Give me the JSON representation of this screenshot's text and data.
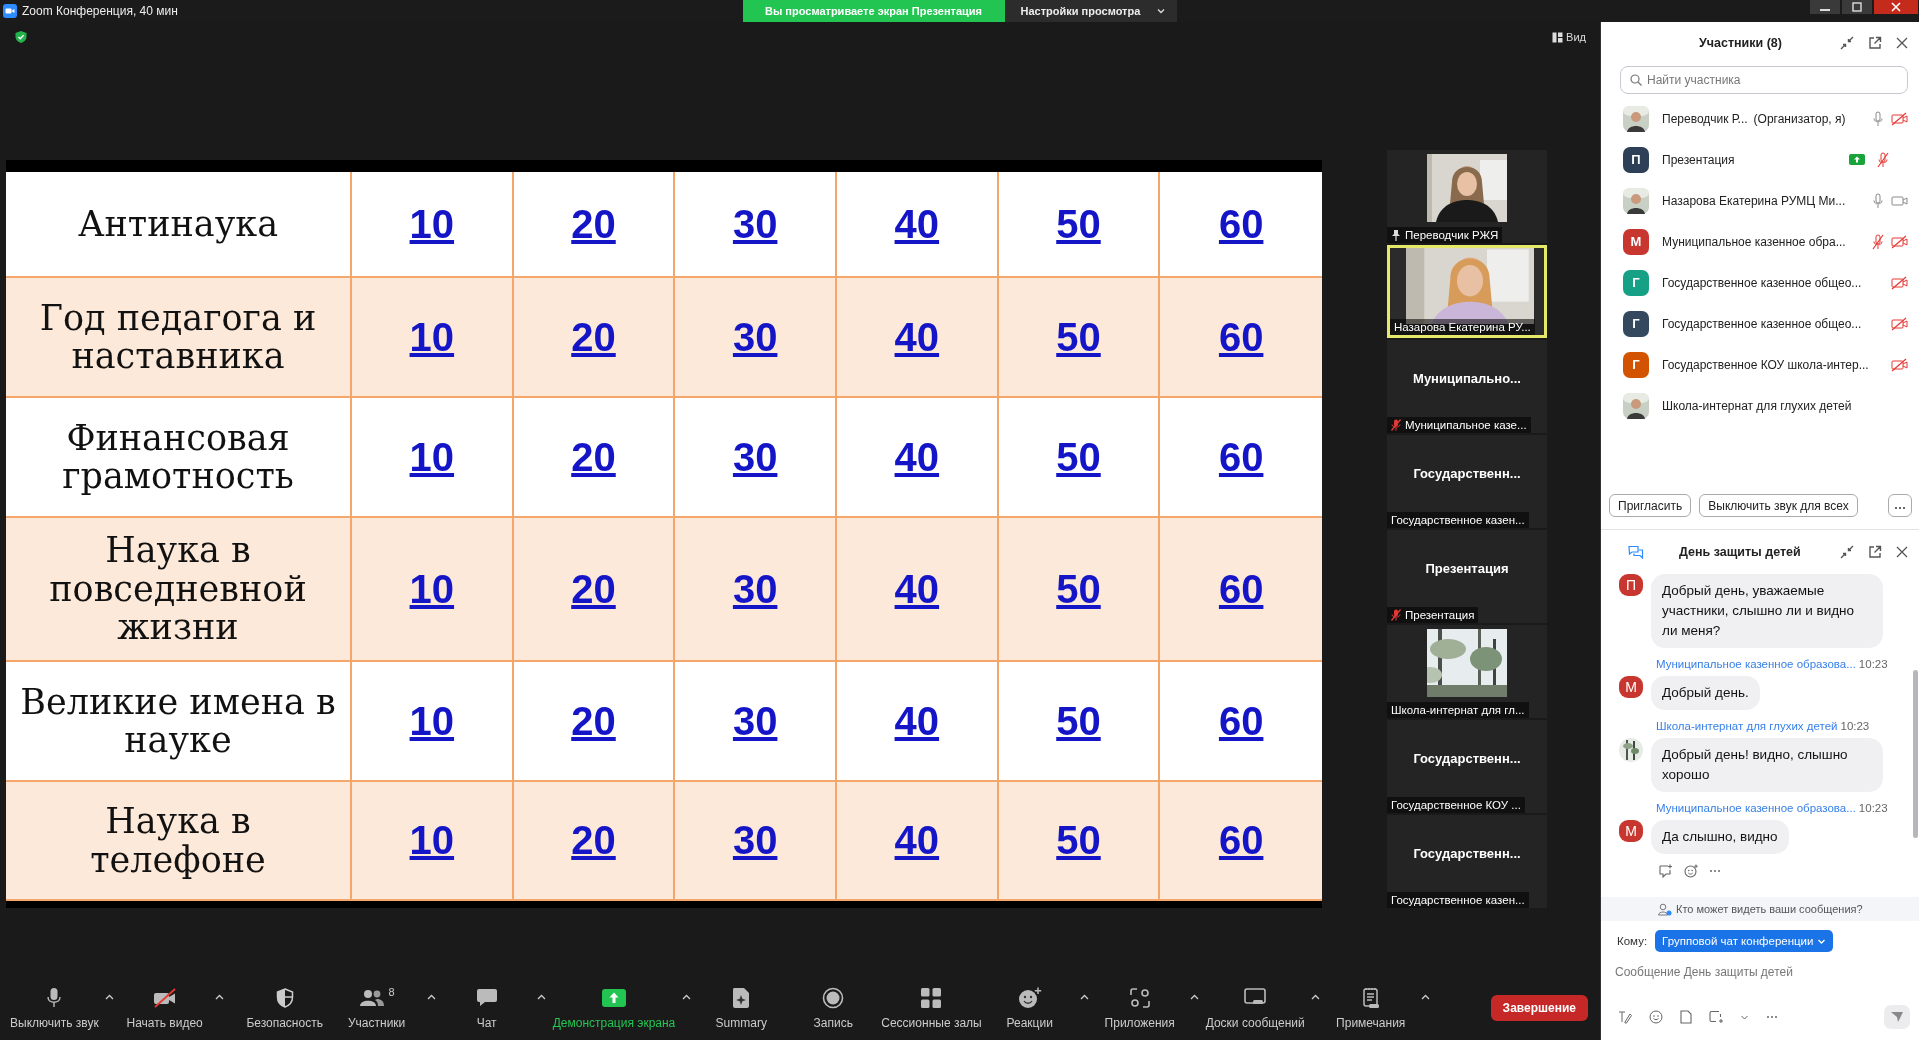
{
  "window": {
    "title": "Zoom Конференция, 40 мин"
  },
  "share_banner": {
    "status": "Вы просматриваете экран Презентация",
    "settings": "Настройки просмотра"
  },
  "view_button": "Вид",
  "slide": {
    "rows": [
      {
        "category": "Антинаука",
        "values": [
          "10",
          "20",
          "30",
          "40",
          "50",
          "60"
        ]
      },
      {
        "category": "Год педагога и наставника",
        "values": [
          "10",
          "20",
          "30",
          "40",
          "50",
          "60"
        ]
      },
      {
        "category": "Финансовая грамотность",
        "values": [
          "10",
          "20",
          "30",
          "40",
          "50",
          "60"
        ]
      },
      {
        "category": "Наука в повседневной жизни",
        "values": [
          "10",
          "20",
          "30",
          "40",
          "50",
          "60"
        ]
      },
      {
        "category": "Великие имена в науке",
        "values": [
          "10",
          "20",
          "30",
          "40",
          "50",
          "60"
        ]
      },
      {
        "category": "Наука в телефоне",
        "values": [
          "10",
          "20",
          "30",
          "40",
          "50",
          "60"
        ]
      }
    ]
  },
  "videos": [
    {
      "kind": "camera",
      "name": "Переводчик РЖЯ",
      "pinned": true,
      "muted": false,
      "speaking": false
    },
    {
      "kind": "camera",
      "name": "Назарова Екатерина РУ...",
      "pinned": false,
      "muted": false,
      "speaking": true
    },
    {
      "kind": "avatar",
      "title": "Муниципально...",
      "name": "Муниципальное казе...",
      "pinned": false,
      "muted": true,
      "speaking": false
    },
    {
      "kind": "avatar",
      "title": "Государственн...",
      "name": "Государственное казен...",
      "pinned": false,
      "muted": false,
      "speaking": false
    },
    {
      "kind": "avatar",
      "title": "Презентация",
      "name": "Презентация",
      "pinned": false,
      "muted": true,
      "speaking": false
    },
    {
      "name": "Школа-интернат для гл...",
      "pinned": false,
      "muted": false,
      "speaking": false
    },
    {
      "kind": "avatar",
      "title": "Государственн...",
      "name": "Государственное КОУ ...",
      "pinned": false,
      "muted": false,
      "speaking": false
    },
    {
      "kind": "avatar",
      "title": "Государственн...",
      "name": "Государственное казен...",
      "pinned": false,
      "muted": false,
      "speaking": false
    }
  ],
  "participants": {
    "title": "Участники (8)",
    "search": {
      "placeholder": "Найти участника"
    },
    "items": [
      {
        "name": "Переводчик Р...",
        "role": "(Организатор, я)",
        "sharing": false,
        "mic": {
          "muted": false
        },
        "camera": {
          "off": true
        }
      },
      {
        "name": "Презентация",
        "avatar": {
          "kind": "letter",
          "letter": "П",
          "color": "#2e4057"
        },
        "sharing": true,
        "mic": {
          "muted": true
        }
      },
      {
        "name": "Назарова Екатерина РУМЦ Ми...",
        "sharing": false,
        "mic": {
          "muted": false
        },
        "camera": {
          "off": false
        }
      },
      {
        "name": "Муниципальное казенное обра...",
        "avatar": {
          "kind": "letter",
          "letter": "М",
          "color": "#c7372f"
        },
        "sharing": false,
        "mic": {
          "muted": true
        },
        "camera": {
          "off": true
        }
      },
      {
        "name": "Государственное казенное общео...",
        "avatar": {
          "kind": "letter",
          "letter": "Г",
          "color": "#16a085"
        },
        "sharing": false,
        "camera": {
          "off": true
        }
      },
      {
        "name": "Государственное казенное общео...",
        "avatar": {
          "kind": "letter",
          "letter": "Г",
          "color": "#34495e"
        },
        "sharing": false,
        "camera": {
          "off": true
        }
      },
      {
        "name": "Государственное КОУ школа-интер...",
        "avatar": {
          "kind": "letter",
          "letter": "Г",
          "color": "#d35400"
        },
        "sharing": false,
        "camera": {
          "off": true
        }
      },
      {
        "name": "Школа-интернат для глухих детей",
        "sharing": false
      }
    ],
    "buttons": [
      "Пригласить",
      "Выключить звук для всех"
    ]
  },
  "chat": {
    "title": "День защиты детей",
    "messages": [
      {
        "avatar": {
          "kind": "letter",
          "letter": "П",
          "color": "#c7372f"
        },
        "text": "Добрый день, уважаемые участники, слышно ли и видно ли меня?"
      },
      {
        "sender": "Муниципальное казенное образова...",
        "time": "10:23",
        "avatar": {
          "kind": "letter",
          "letter": "М",
          "color": "#c7372f"
        },
        "text": "Добрый день."
      },
      {
        "sender": "Школа-интернат для глухих детей",
        "time": "10:23",
        "text": "Добрый день! видно, слышно хорошо"
      },
      {
        "sender": "Муниципальное казенное образова...",
        "time": "10:23",
        "avatar": {
          "kind": "letter",
          "letter": "М",
          "color": "#c7372f"
        },
        "text": "Да слышно, видно"
      }
    ],
    "privacy": "Кто может видеть ваши сообщения?",
    "to_label": "Кому:",
    "recipient": "Групповой чат конференции",
    "input": {
      "placeholder": "Сообщение День защиты детей"
    }
  },
  "toolbar": [
    {
      "kind": "mic",
      "label": "Выключить звук",
      "caret": true,
      "active": false
    },
    {
      "kind": "video-off",
      "label": "Начать видео",
      "caret": true,
      "active": false
    },
    {
      "kind": "shield",
      "label": "Безопасность",
      "caret": false,
      "active": false
    },
    {
      "kind": "people",
      "label": "Участники",
      "count": "8",
      "caret": true,
      "active": false
    },
    {
      "kind": "chat",
      "label": "Чат",
      "caret": true,
      "active": false
    },
    {
      "kind": "share",
      "label": "Демонстрация экрана",
      "caret": true,
      "active": true
    },
    {
      "kind": "summary",
      "label": "Summary",
      "caret": false,
      "active": false
    },
    {
      "kind": "record",
      "label": "Запись",
      "caret": false,
      "active": false
    },
    {
      "kind": "rooms",
      "label": "Сессионные залы",
      "caret": false,
      "active": false
    },
    {
      "kind": "reactions",
      "label": "Реакции",
      "caret": true,
      "active": false
    },
    {
      "kind": "apps",
      "label": "Приложения",
      "caret": true,
      "active": false
    },
    {
      "kind": "board",
      "label": "Доски сообщений",
      "caret": true,
      "active": false
    },
    {
      "kind": "notes",
      "label": "Примечания",
      "caret": true,
      "active": false
    }
  ],
  "end_button": "Завершение"
}
